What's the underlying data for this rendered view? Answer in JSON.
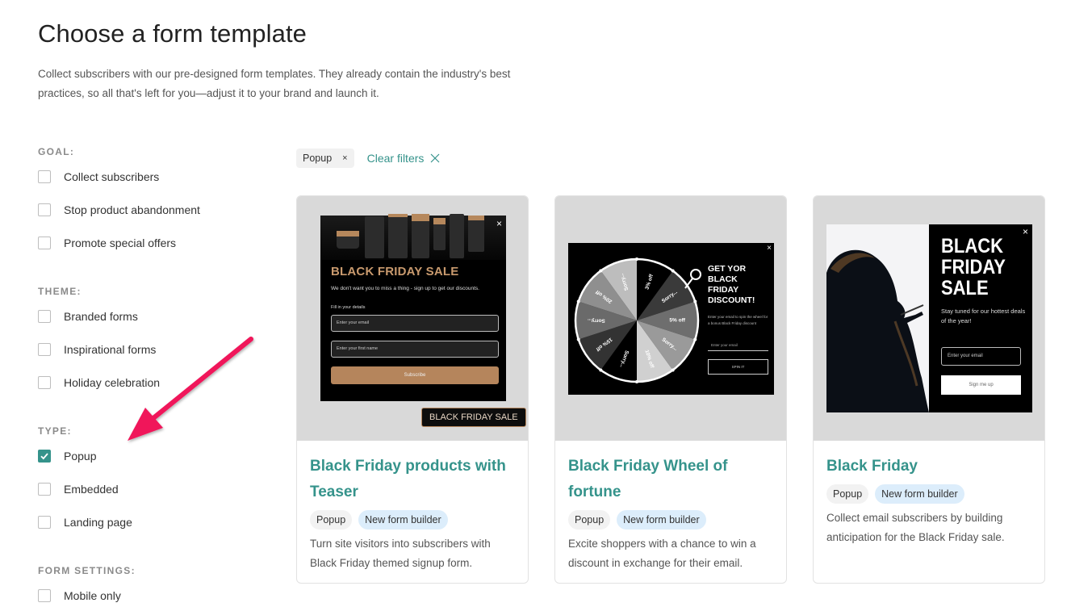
{
  "header": {
    "title": "Choose a form template",
    "description": "Collect subscribers with our pre-designed form templates. They already contain the industry's best practices, so all that's left for you—adjust it to your brand and launch it."
  },
  "filters": {
    "groups": [
      {
        "heading": "GOAL:",
        "items": [
          {
            "label": "Collect subscribers",
            "checked": false
          },
          {
            "label": "Stop product abandonment",
            "checked": false
          },
          {
            "label": "Promote special offers",
            "checked": false
          }
        ]
      },
      {
        "heading": "THEME:",
        "items": [
          {
            "label": "Branded forms",
            "checked": false
          },
          {
            "label": "Inspirational forms",
            "checked": false
          },
          {
            "label": "Holiday celebration",
            "checked": false
          }
        ]
      },
      {
        "heading": "TYPE:",
        "items": [
          {
            "label": "Popup",
            "checked": true
          },
          {
            "label": "Embedded",
            "checked": false
          },
          {
            "label": "Landing page",
            "checked": false
          }
        ]
      },
      {
        "heading": "FORM SETTINGS:",
        "items": [
          {
            "label": "Mobile only",
            "checked": false
          }
        ]
      }
    ]
  },
  "active_filters": {
    "chips": [
      {
        "label": "Popup",
        "remove_icon": "×"
      }
    ],
    "clear_label": "Clear filters"
  },
  "colors": {
    "accent": "#35938b",
    "annotation_arrow": "#f0145a",
    "badge_blue": "#dcedfb",
    "badge_grey": "#f2f2f2"
  },
  "cards": [
    {
      "title": "Black Friday products with Teaser",
      "badges": [
        "Popup",
        "New form builder"
      ],
      "description": "Turn site visitors into subscribers with Black Friday themed signup form.",
      "preview": {
        "close": "×",
        "heading": "BLACK FRIDAY SALE",
        "subheading": "We don't want you to miss a thing - sign up to get our discounts.",
        "fields_label": "Fill in your details",
        "email_placeholder": "Enter your email",
        "name_placeholder": "Enter your first name",
        "button": "Subscribe",
        "teaser": "BLACK FRIDAY SALE"
      }
    },
    {
      "title": "Black Friday Wheel of fortune",
      "badges": [
        "Popup",
        "New form builder"
      ],
      "description": "Excite shoppers with a chance to win a discount in exchange for their email.",
      "preview": {
        "close": "×",
        "heading": "GET YOR BLACK FRIDAY DISCOUNT!",
        "subheading": "Enter your email to spin the wheel for a bonus Black Friday discount",
        "email_placeholder": "Enter your email",
        "button": "SPIN IT",
        "wheel_segments": [
          "3% off",
          "Sorry...",
          "5% off",
          "Sorry...",
          "10% off",
          "Sorry...",
          "15% off",
          "Sorry...",
          "20% off",
          "Sorry..."
        ]
      }
    },
    {
      "title": "Black Friday",
      "badges": [
        "Popup",
        "New form builder"
      ],
      "description": "Collect email subscribers by building anticipation for the Black Friday sale.",
      "preview": {
        "close": "×",
        "heading": "BLACK FRIDAY SALE",
        "subheading": "Stay tuned for our hottest deals of the year!",
        "email_placeholder": "Enter your email",
        "button": "Sign me up"
      }
    }
  ]
}
